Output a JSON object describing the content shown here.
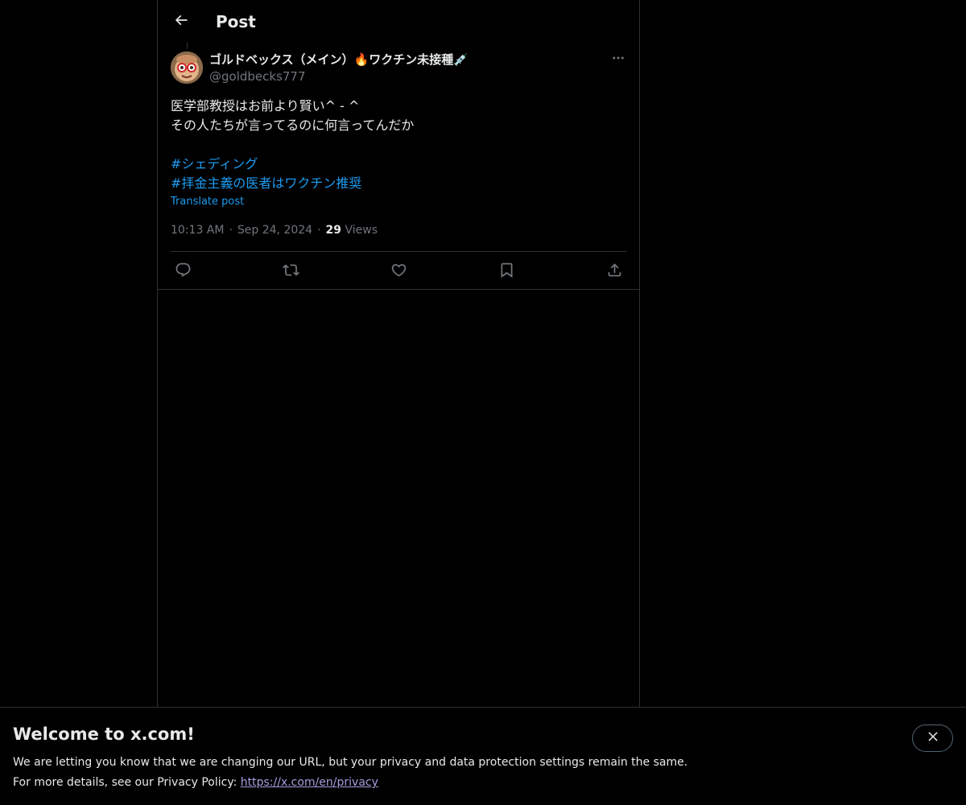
{
  "header": {
    "title": "Post"
  },
  "tweet": {
    "display_name": "ゴルドベックス（メイン）🔥ワクチン未接種💉",
    "handle": "@goldbecks777",
    "body_lines": [
      "医学部教授はお前より賢い^ - ^",
      "その人たちが言ってるのに何言ってんだか"
    ],
    "hashtags": [
      "#シェディング",
      "#拝金主義の医者はワクチン推奨"
    ],
    "translate_label": "Translate post",
    "time": "10:13 AM",
    "date": "Sep 24, 2024",
    "views_count": "29",
    "views_label": "Views"
  },
  "banner": {
    "title": "Welcome to x.com!",
    "line1": "We are letting you know that we are changing our URL, but your privacy and data protection settings remain the same.",
    "line2_prefix": "For more details, see our Privacy Policy: ",
    "link": "https://x.com/en/privacy"
  },
  "colors": {
    "background": "#000000",
    "text": "#e7e9ea",
    "secondary": "#71767b",
    "link": "#1d9bf0",
    "border": "#2f3336"
  },
  "icons": {
    "back": "arrow-left-icon",
    "more": "more-horizontal-icon",
    "reply": "reply-icon",
    "repost": "repost-icon",
    "like": "heart-icon",
    "bookmark": "bookmark-icon",
    "share": "share-icon",
    "close": "close-icon"
  }
}
